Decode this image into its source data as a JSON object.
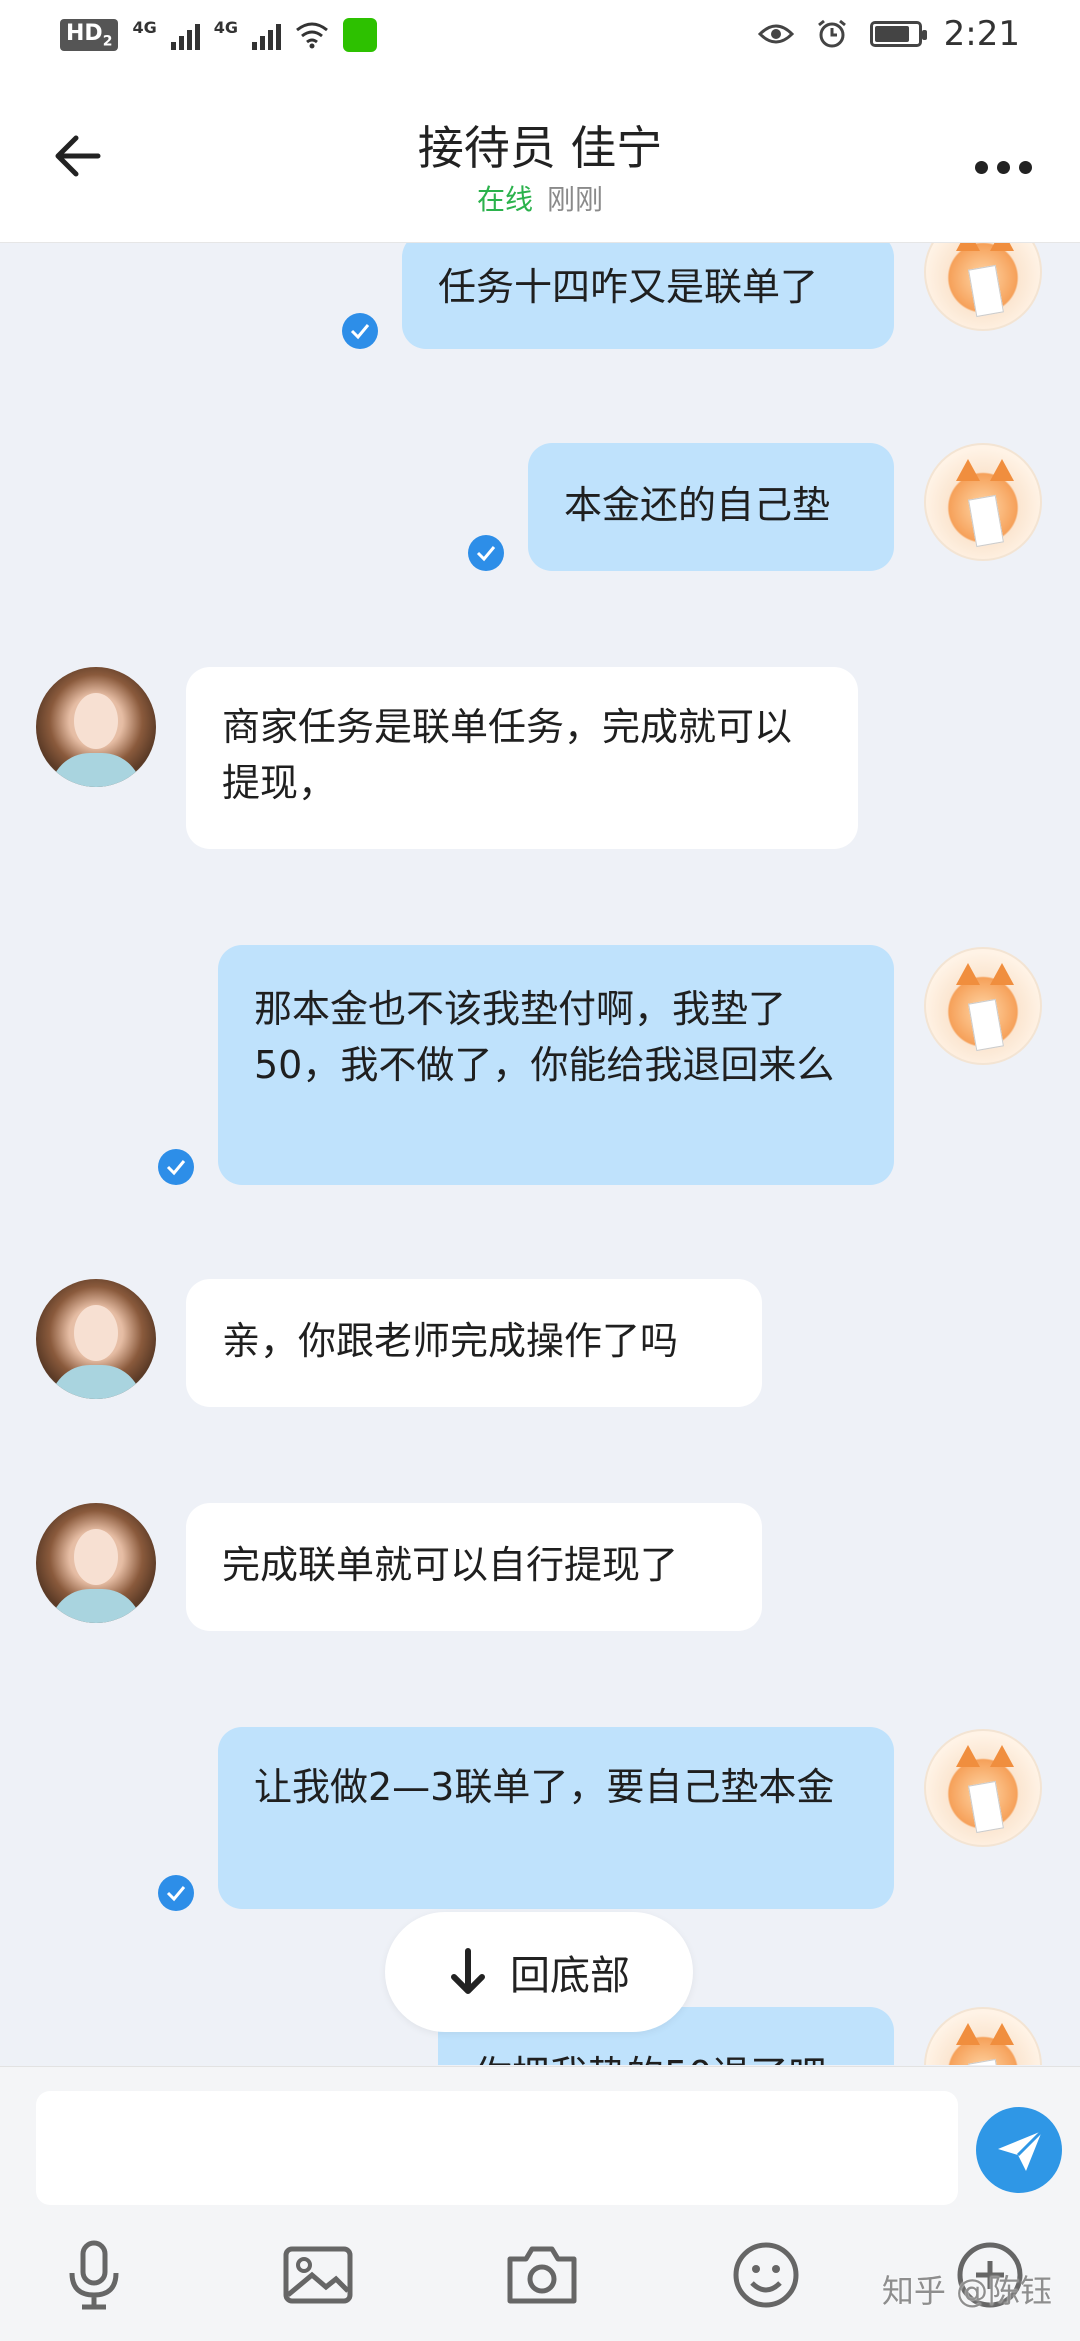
{
  "status_bar": {
    "hd": "HD",
    "hd_sub": "2",
    "net1": "4G",
    "net2": "4G",
    "time": "2:21"
  },
  "header": {
    "title": "接待员 佳宁",
    "status_online": "在线",
    "status_time": "刚刚"
  },
  "messages": [
    {
      "side": "out",
      "text": "任务十四咋又是联单了",
      "read": true
    },
    {
      "side": "out",
      "text": "本金还的自己垫",
      "read": true
    },
    {
      "side": "in",
      "text": "商家任务是联单任务，完成就可以提现，"
    },
    {
      "side": "out",
      "text": "那本金也不该我垫付啊，我垫了50，我不做了，你能给我退回来么",
      "read": true
    },
    {
      "side": "in",
      "text": "亲，你跟老师完成操作了吗"
    },
    {
      "side": "in",
      "text": "完成联单就可以自行提现了"
    },
    {
      "side": "out",
      "text": "让我做2—3联单了，要自己垫本金",
      "read": true
    },
    {
      "side": "out",
      "text": "你把我垫的50退了吧",
      "read": false
    }
  ],
  "back_to_bottom": "回底部",
  "input": {
    "placeholder": ""
  },
  "watermark": "知乎 @陈钰",
  "colors": {
    "outgoing_bubble": "#bfe2fc",
    "incoming_bubble": "#ffffff",
    "online": "#2bb24c",
    "send_button": "#2f97e6",
    "read_check": "#2d8ee8"
  },
  "icons": {
    "back": "arrow-left-icon",
    "more": "more-dots-icon",
    "send": "paper-plane-icon",
    "tools": [
      "microphone-icon",
      "image-icon",
      "camera-icon",
      "emoji-icon",
      "plus-icon"
    ]
  }
}
